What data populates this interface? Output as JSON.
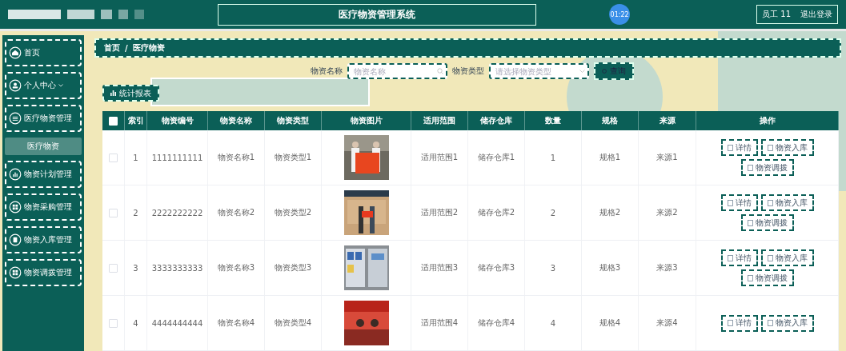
{
  "header": {
    "title": "医疗物资管理系统",
    "timer": "01:22",
    "user": "员工 11",
    "logout": "退出登录"
  },
  "sidebar": {
    "items": [
      {
        "label": "首页",
        "kind": "home"
      },
      {
        "label": "个人中心",
        "kind": "user",
        "expanded": false
      },
      {
        "label": "医疗物资管理",
        "kind": "list",
        "expanded": true,
        "children": [
          {
            "label": "医疗物资",
            "selected": true
          }
        ]
      },
      {
        "label": "物资计划管理",
        "kind": "chart"
      },
      {
        "label": "物资采购管理",
        "kind": "grid"
      },
      {
        "label": "物资入库管理",
        "kind": "box"
      },
      {
        "label": "物资调拨管理",
        "kind": "grid"
      }
    ]
  },
  "breadcrumb": {
    "items": [
      "首页",
      "医疗物资"
    ],
    "separator": "/"
  },
  "search": {
    "fields": [
      {
        "label": "物资名称",
        "placeholder": "物资名称",
        "kind": "text"
      },
      {
        "label": "物资类型",
        "placeholder": "请选择物资类型",
        "kind": "select"
      }
    ],
    "button": "查询"
  },
  "report_button": "统计报表",
  "table": {
    "all_checked": false,
    "columns": [
      "索引",
      "物资编号",
      "物资名称",
      "物资类型",
      "物资图片",
      "适用范围",
      "储存仓库",
      "数量",
      "规格",
      "来源",
      "操作"
    ],
    "rows": [
      {
        "checked": false,
        "cells": [
          {
            "kind": "text",
            "text": "1"
          },
          {
            "kind": "text",
            "text": "1111111111"
          },
          {
            "kind": "text",
            "text": "物资名称1"
          },
          {
            "kind": "text",
            "text": "物资类型1"
          },
          {
            "kind": "picture"
          },
          {
            "kind": "text",
            "text": "适用范围1"
          },
          {
            "kind": "text",
            "text": "储存仓库1"
          },
          {
            "kind": "text",
            "text": "1"
          },
          {
            "kind": "text",
            "text": "规格1"
          },
          {
            "kind": "text",
            "text": "来源1"
          },
          {
            "kind": "actions",
            "buttons": [
              "详情",
              "物资入库",
              "物资调拨"
            ]
          }
        ]
      },
      {
        "checked": false,
        "cells": [
          {
            "kind": "text",
            "text": "2"
          },
          {
            "kind": "text",
            "text": "2222222222"
          },
          {
            "kind": "text",
            "text": "物资名称2"
          },
          {
            "kind": "text",
            "text": "物资类型2"
          },
          {
            "kind": "picture"
          },
          {
            "kind": "text",
            "text": "适用范围2"
          },
          {
            "kind": "text",
            "text": "储存仓库2"
          },
          {
            "kind": "text",
            "text": "2"
          },
          {
            "kind": "text",
            "text": "规格2"
          },
          {
            "kind": "text",
            "text": "来源2"
          },
          {
            "kind": "actions",
            "buttons": [
              "详情",
              "物资入库",
              "物资调拨"
            ]
          }
        ]
      },
      {
        "checked": false,
        "cells": [
          {
            "kind": "text",
            "text": "3"
          },
          {
            "kind": "text",
            "text": "3333333333"
          },
          {
            "kind": "text",
            "text": "物资名称3"
          },
          {
            "kind": "text",
            "text": "物资类型3"
          },
          {
            "kind": "picture"
          },
          {
            "kind": "text",
            "text": "适用范围3"
          },
          {
            "kind": "text",
            "text": "储存仓库3"
          },
          {
            "kind": "text",
            "text": "3"
          },
          {
            "kind": "text",
            "text": "规格3"
          },
          {
            "kind": "text",
            "text": "来源3"
          },
          {
            "kind": "actions",
            "buttons": [
              "详情",
              "物资入库",
              "物资调拨"
            ]
          }
        ]
      },
      {
        "checked": false,
        "cells": [
          {
            "kind": "text",
            "text": "4"
          },
          {
            "kind": "text",
            "text": "4444444444"
          },
          {
            "kind": "text",
            "text": "物资名称4"
          },
          {
            "kind": "text",
            "text": "物资类型4"
          },
          {
            "kind": "picture"
          },
          {
            "kind": "text",
            "text": "适用范围4"
          },
          {
            "kind": "text",
            "text": "储存仓库4"
          },
          {
            "kind": "text",
            "text": "4"
          },
          {
            "kind": "text",
            "text": "规格4"
          },
          {
            "kind": "text",
            "text": "来源4"
          },
          {
            "kind": "actions",
            "buttons": [
              "详情",
              "物资入库"
            ]
          }
        ]
      }
    ]
  }
}
